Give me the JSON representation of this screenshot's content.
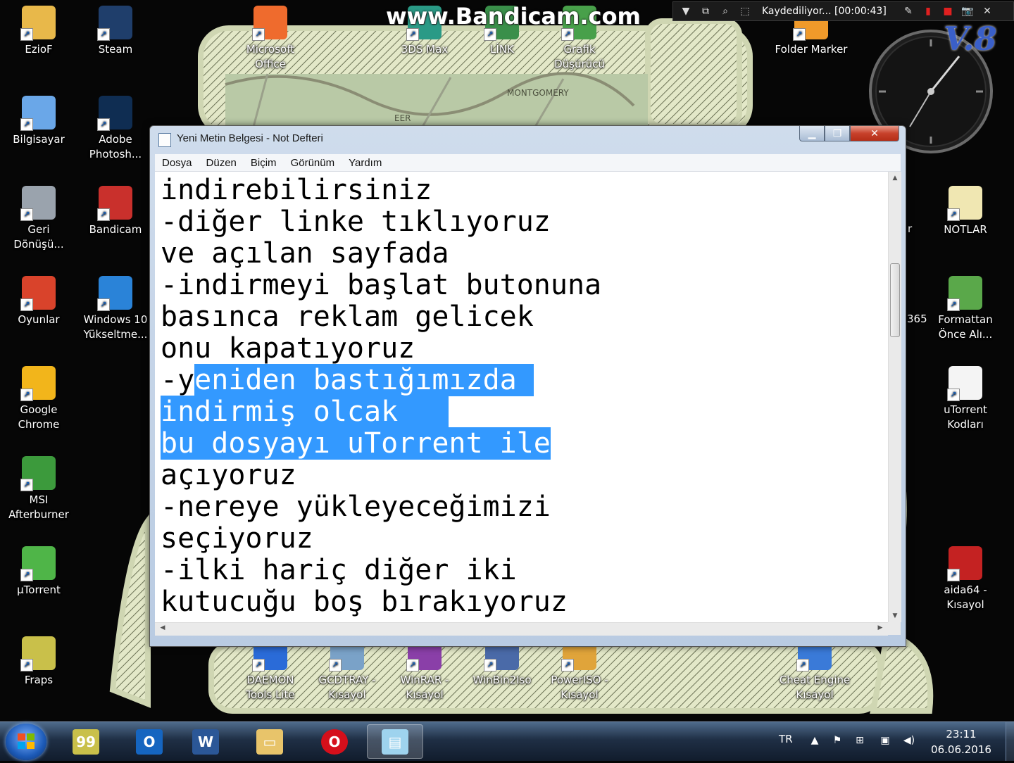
{
  "desktop": {
    "left_icons": [
      {
        "label": "EzioF",
        "icon": "folder-user-icon",
        "color": "#e8b84a"
      },
      {
        "label": "Bilgisayar",
        "icon": "computer-icon",
        "color": "#6aa7e8"
      },
      {
        "label": "Geri\nDönüşü...",
        "icon": "recycle-bin-icon",
        "color": "#9aa3ad"
      },
      {
        "label": "Oyunlar",
        "icon": "games-icon",
        "color": "#d9432b"
      },
      {
        "label": "Google\nChrome",
        "icon": "chrome-icon",
        "color": "#f2b51b"
      },
      {
        "label": "MSI\nAfterburner",
        "icon": "afterburner-icon",
        "color": "#3c9a3c"
      },
      {
        "label": "µTorrent",
        "icon": "utorrent-icon",
        "color": "#4fb548"
      },
      {
        "label": "Fraps",
        "icon": "fraps-icon",
        "color": "#c9c04a"
      }
    ],
    "second_icons": [
      {
        "label": "Steam",
        "icon": "steam-icon",
        "color": "#1f3e6b"
      },
      {
        "label": "Adobe\nPhotosh...",
        "icon": "photoshop-icon",
        "color": "#0f2d52"
      },
      {
        "label": "Bandicam",
        "icon": "bandicam-icon",
        "color": "#c9302c"
      },
      {
        "label": "Windows 10\nYükseltme...",
        "icon": "windows-icon",
        "color": "#2a83d8"
      }
    ],
    "top_icons": [
      {
        "label": "Microsoft\nOffice",
        "icon": "office-icon",
        "color": "#ef6b2d"
      },
      {
        "label": "3DS Max",
        "icon": "3dsmax-icon",
        "color": "#2a9a86"
      },
      {
        "label": "LİNK",
        "icon": "link-icon",
        "color": "#3a8f4a"
      },
      {
        "label": "Grafik\nDüşürücü",
        "icon": "graphic-icon",
        "color": "#48a04a"
      },
      {
        "label": "Folder Marker",
        "icon": "folder-marker-icon",
        "color": "#f09a2a"
      }
    ],
    "right_icons": [
      {
        "label": "NOTLAR",
        "icon": "notes-icon",
        "color": "#f0e7b2"
      },
      {
        "label": "Formattan\nÖnce Alı...",
        "icon": "usb-icon",
        "color": "#5aa84a"
      },
      {
        "label": "uTorrent\nKodları",
        "icon": "text-file-icon",
        "color": "#f4f4f4"
      },
      {
        "label": "aida64 -\nKısayol",
        "icon": "aida64-icon",
        "color": "#c42222"
      }
    ],
    "partial_labels": [
      "r",
      "365"
    ],
    "bottom_icons": [
      {
        "label": "DAEMON\nTools Lite",
        "icon": "daemon-icon",
        "color": "#2a6bd8"
      },
      {
        "label": "GCDTRAY -\nKısayol",
        "icon": "gcdtray-icon",
        "color": "#7aa2c8"
      },
      {
        "label": "WinRAR -\nKısayol",
        "icon": "winrar-icon",
        "color": "#8a3fa8"
      },
      {
        "label": "WinBin2Iso",
        "icon": "winbin2iso-icon",
        "color": "#4a6aa8"
      },
      {
        "label": "PowerISO -\nKısayol",
        "icon": "poweriso-icon",
        "color": "#e0a43a"
      },
      {
        "label": "Cheat Engine\nKısayol",
        "icon": "cheat-engine-icon",
        "color": "#3a7ad8"
      }
    ],
    "wallpaper_text": "MONTGOMERY"
  },
  "bandicam": {
    "watermark": "www.Bandicam.com",
    "status": "Kaydediliyor... [00:00:43]"
  },
  "notepad": {
    "title": "Yeni Metin Belgesi - Not Defteri",
    "menu": [
      "Dosya",
      "Düzen",
      "Biçim",
      "Görünüm",
      "Yardım"
    ],
    "lines": [
      {
        "text": "indirebilirsiniz",
        "sel": ""
      },
      {
        "text": "-diğer linke tıklıyoruz",
        "sel": ""
      },
      {
        "text": "ve açılan sayfada",
        "sel": ""
      },
      {
        "text": "-indirmeyi başlat butonuna",
        "sel": ""
      },
      {
        "text": "basınca reklam gelicek",
        "sel": ""
      },
      {
        "text": "onu kapatıyoruz",
        "sel": ""
      },
      {
        "text": "-y",
        "sel": "eniden bastığımızda "
      },
      {
        "text": "",
        "sel": "indirmiş olcak   "
      },
      {
        "text": "",
        "sel": "bu dosyayı uTorrent ile"
      },
      {
        "text": "açıyoruz",
        "sel": ""
      },
      {
        "text": "-nereye yükleyeceğimizi",
        "sel": ""
      },
      {
        "text": "seçiyoruz",
        "sel": ""
      },
      {
        "text": "-ilki hariç diğer iki",
        "sel": ""
      },
      {
        "text": "kutucuğu boş bırakıyoruz",
        "sel": ""
      }
    ],
    "selection_color": "#3399ff"
  },
  "taskbar": {
    "buttons": [
      {
        "name": "fraps-taskbar",
        "icon": "fraps-icon",
        "color": "#c9c04a",
        "active": false
      },
      {
        "name": "outlook-taskbar",
        "icon": "outlook-icon",
        "color": "#1565c0",
        "active": false
      },
      {
        "name": "word-taskbar",
        "icon": "word-icon",
        "color": "#2b5797",
        "active": false
      },
      {
        "name": "explorer-taskbar",
        "icon": "folder-icon",
        "color": "#e8c46a",
        "active": false
      },
      {
        "name": "opera-taskbar",
        "icon": "opera-icon",
        "color": "#d50f1b",
        "active": false
      },
      {
        "name": "notepad-taskbar",
        "icon": "notepad-icon",
        "color": "#9ed3ee",
        "active": true
      }
    ],
    "language": "TR",
    "time": "23:11",
    "date": "06.06.2016"
  }
}
